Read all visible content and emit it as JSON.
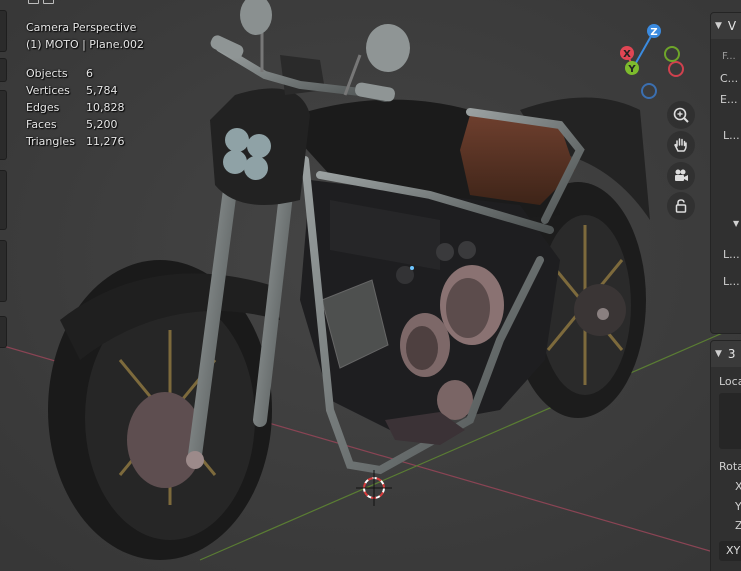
{
  "viewport": {
    "view_name": "Camera Perspective",
    "object_name": "(1) MOTO | Plane.002",
    "stats": [
      {
        "label": "Objects",
        "value": "6"
      },
      {
        "label": "Vertices",
        "value": "5,784"
      },
      {
        "label": "Edges",
        "value": "10,828"
      },
      {
        "label": "Faces",
        "value": "5,200"
      },
      {
        "label": "Triangles",
        "value": "11,276"
      }
    ]
  },
  "gizmo": {
    "x_label": "X",
    "y_label": "Y",
    "z_label": "Z",
    "x_color": "#e04654",
    "y_color": "#7dbb2d",
    "z_color": "#3b8be0"
  },
  "nav_buttons": [
    "zoom-icon",
    "hand-icon",
    "camera-icon",
    "lock-icon"
  ],
  "sidebar": {
    "view_panel": {
      "title": "V",
      "rows": [
        "F...",
        "C...",
        "E...",
        "L..."
      ]
    },
    "lower_rows": [
      "L...",
      "L..."
    ],
    "transform_panel": {
      "title": "3",
      "location_label": "Loca",
      "rotation_label": "Rota",
      "axes": [
        "X",
        "Y",
        "Z"
      ],
      "mode_value": "XY"
    }
  }
}
